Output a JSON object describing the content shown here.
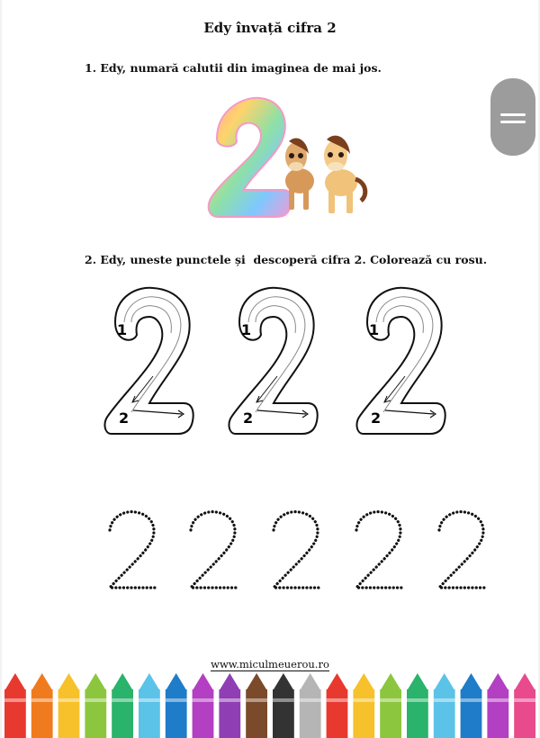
{
  "document": {
    "title": "Edy învață cifra 2",
    "task1": "1. Edy, numară calutii din imaginea de mai jos.",
    "task2": "2. Edy, uneste punctele și  descoperă cifra 2. Colorează cu rosu.",
    "footer_url": "www.miculmeuerou.ro"
  },
  "tracing_digits": [
    {
      "start_label": "1",
      "end_label": "2"
    },
    {
      "start_label": "1",
      "end_label": "2"
    },
    {
      "start_label": "1",
      "end_label": "2"
    }
  ],
  "dotted_digit_count": 5,
  "picture": {
    "digit": "2",
    "horses": 2
  },
  "crayon_colors": [
    "#e8392f",
    "#f07b1e",
    "#f6c12b",
    "#8cc63f",
    "#2ab36b",
    "#5bc3e8",
    "#1f7cc8",
    "#b33fc2",
    "#8f3fb3",
    "#7a4a2a",
    "#333333",
    "#b5b5b5",
    "#e8392f",
    "#f6c12b",
    "#8cc63f",
    "#2ab36b",
    "#5bc3e8",
    "#1f7cc8",
    "#b33fc2",
    "#e84a8c"
  ],
  "menu": {
    "icon": "menu-icon"
  }
}
